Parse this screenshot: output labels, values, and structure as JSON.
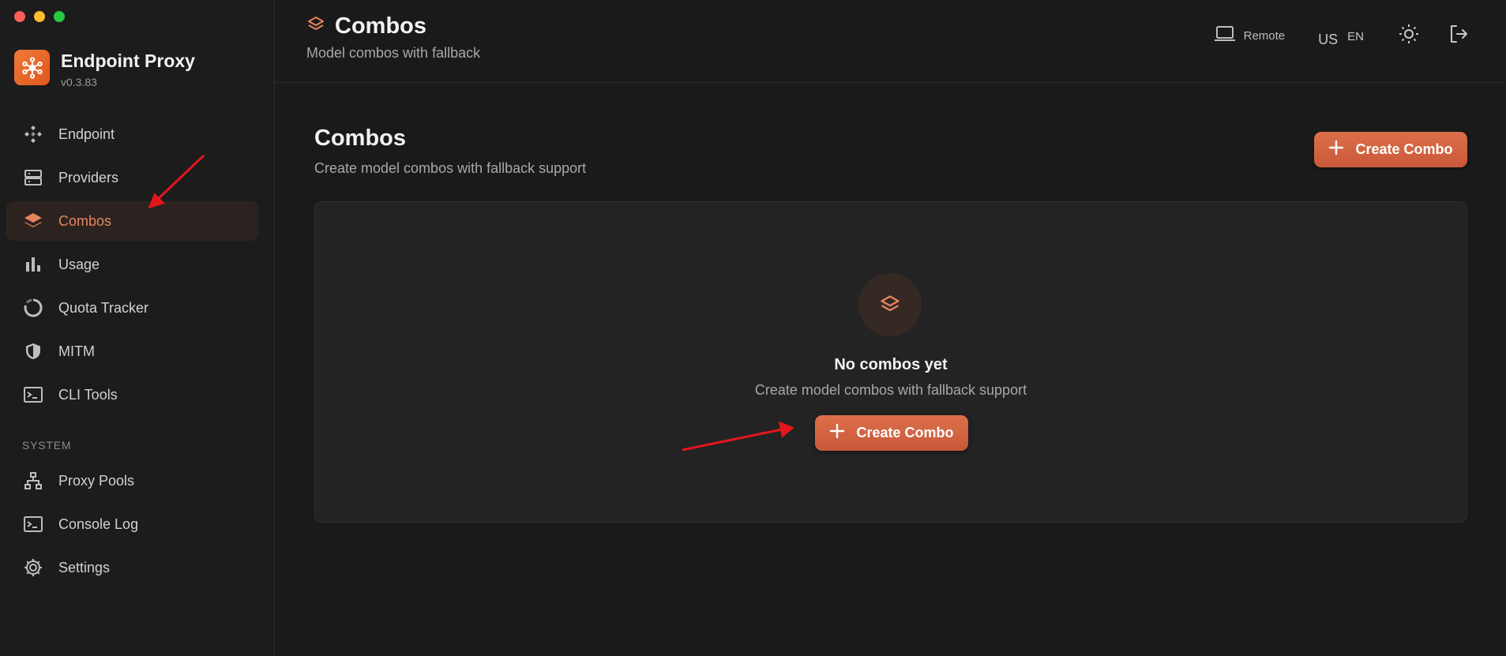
{
  "window": {
    "controls": [
      "close",
      "minimize",
      "maximize"
    ]
  },
  "brand": {
    "name": "Endpoint Proxy",
    "version": "v0.3.83",
    "logo_icon": "network-hub-icon"
  },
  "sidebar": {
    "items": [
      {
        "label": "Endpoint",
        "icon": "endpoint-icon",
        "active": false
      },
      {
        "label": "Providers",
        "icon": "server-icon",
        "active": false
      },
      {
        "label": "Combos",
        "icon": "layers-icon",
        "active": true
      },
      {
        "label": "Usage",
        "icon": "bar-chart-icon",
        "active": false
      },
      {
        "label": "Quota Tracker",
        "icon": "ring-gauge-icon",
        "active": false
      },
      {
        "label": "MITM",
        "icon": "shield-icon",
        "active": false
      },
      {
        "label": "CLI Tools",
        "icon": "terminal-icon",
        "active": false
      }
    ],
    "section_label": "SYSTEM",
    "system_items": [
      {
        "label": "Proxy Pools",
        "icon": "sitemap-icon"
      },
      {
        "label": "Console Log",
        "icon": "console-icon"
      },
      {
        "label": "Settings",
        "icon": "gear-icon"
      }
    ]
  },
  "header": {
    "title": "Combos",
    "subtitle": "Model combos with fallback",
    "remote_label": "Remote",
    "lang_flag": "US",
    "lang_code": "EN"
  },
  "main": {
    "title": "Combos",
    "subtitle": "Create model combos with fallback support",
    "create_button_label": "Create Combo",
    "empty_state": {
      "title": "No combos yet",
      "subtitle": "Create model combos with fallback support",
      "button_label": "Create Combo"
    }
  },
  "colors": {
    "accent": "#e6845e",
    "button": "#d4653f",
    "annotation_arrow": "#e3161c",
    "background": "#1a1a1a"
  }
}
